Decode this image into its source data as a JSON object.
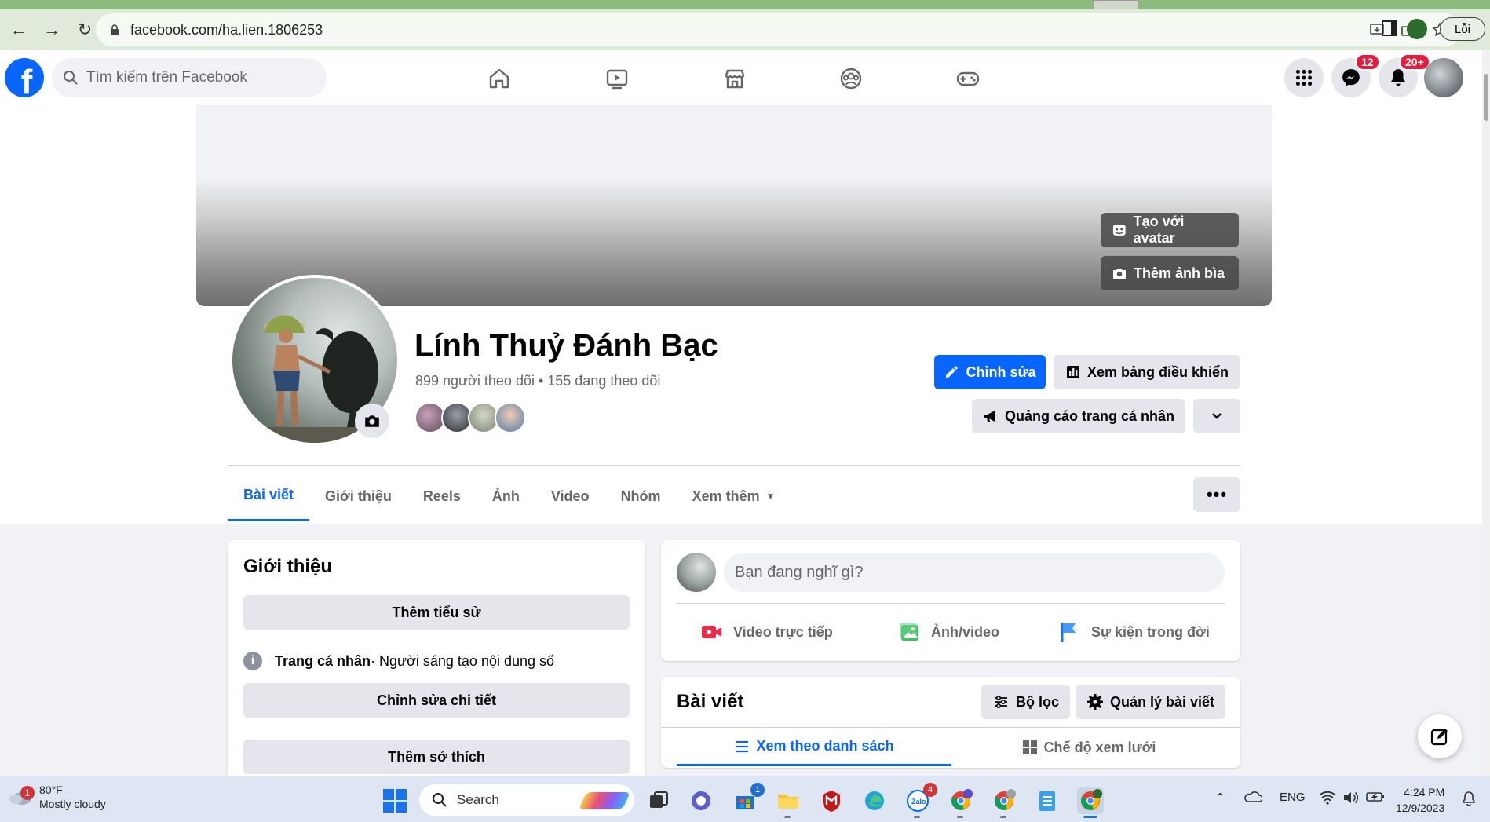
{
  "browser": {
    "url": "facebook.com/ha.lien.1806253",
    "profile_chip": "Lỗi"
  },
  "header": {
    "search_placeholder": "Tìm kiếm trên Facebook",
    "messenger_badge": "12",
    "notifications_badge": "20+",
    "nav_icons": [
      "home-icon",
      "video-icon",
      "marketplace-icon",
      "groups-icon",
      "gaming-icon"
    ]
  },
  "cover": {
    "avatar_button": "Tạo với avatar",
    "cover_button": "Thêm ảnh bìa"
  },
  "profile": {
    "name": "Lính Thuỷ Đánh Bạc",
    "stats": "899 người theo dõi • 155 đang theo dõi",
    "edit_button": "Chỉnh sửa",
    "dashboard_button": "Xem bảng điều khiển",
    "ads_button": "Quảng cáo trang cá nhân"
  },
  "tabs": [
    {
      "label": "Bài viết",
      "active": true
    },
    {
      "label": "Giới thiệu"
    },
    {
      "label": "Reels"
    },
    {
      "label": "Ảnh"
    },
    {
      "label": "Video"
    },
    {
      "label": "Nhóm"
    },
    {
      "label": "Xem thêm"
    }
  ],
  "more_button": "•••",
  "intro": {
    "title": "Giới thiệu",
    "bio_button": "Thêm tiểu sử",
    "page_type_label": "Trang cá nhân",
    "page_type_value": " · Người sáng tạo nội dung số",
    "edit_details_button": "Chỉnh sửa chi tiết",
    "hobbies_button": "Thêm sở thích"
  },
  "composer": {
    "placeholder": "Bạn đang nghĩ gì?",
    "live_video": "Video trực tiếp",
    "photo_video": "Ảnh/video",
    "life_event": "Sự kiện trong đời"
  },
  "posts": {
    "title": "Bài viết",
    "filter_button": "Bộ lọc",
    "manage_button": "Quản lý bài viết",
    "list_view": "Xem theo danh sách",
    "grid_view": "Chế độ xem lưới"
  },
  "taskbar": {
    "temperature": "80°F",
    "weather": "Mostly cloudy",
    "weather_badge": "1",
    "search_label": "Search",
    "store_badge": "1",
    "zalo_badge": "4",
    "language": "ENG",
    "time": "4:24 PM",
    "date": "12/9/2023"
  },
  "colors": {
    "fb_blue": "#0866ff",
    "badge_red": "#e41e3f"
  }
}
